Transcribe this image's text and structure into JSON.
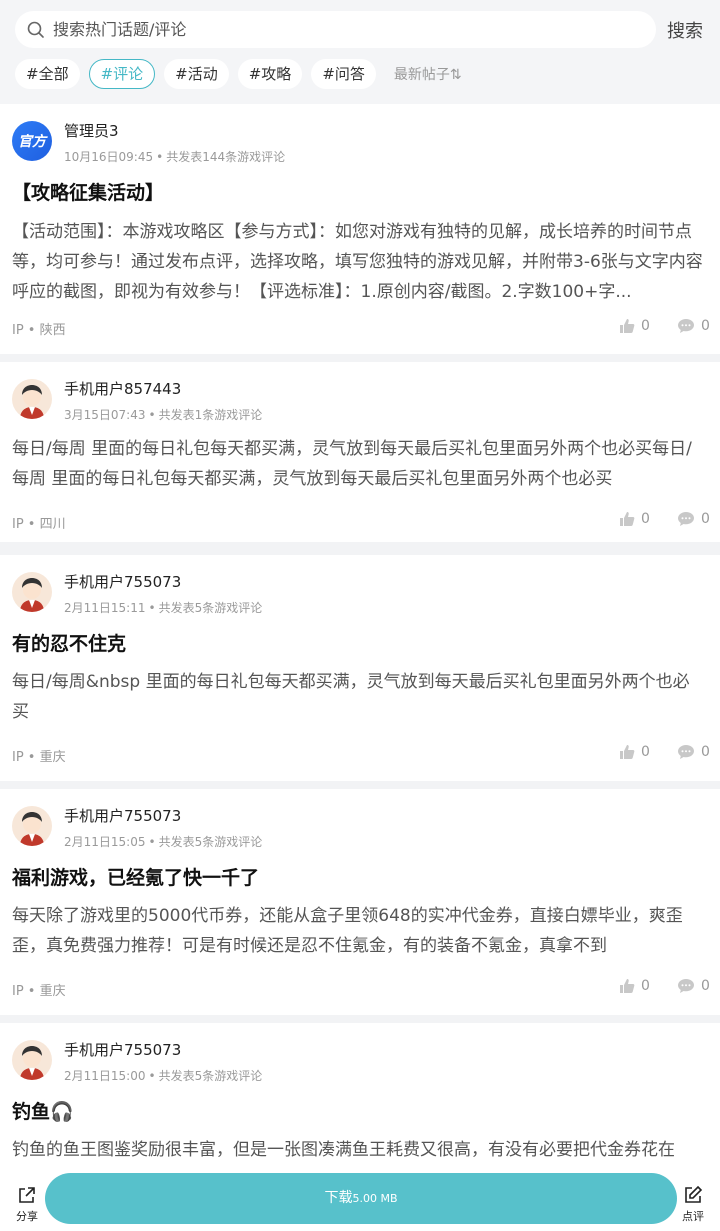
{
  "search": {
    "placeholder": "搜索热门话题/评论",
    "button_label": "搜索"
  },
  "tags": [
    "#全部",
    "#评论",
    "#活动",
    "#攻略",
    "#问答"
  ],
  "active_tag_index": 1,
  "sort_label": "最新帖子⇅",
  "posts": [
    {
      "user": "管理员3",
      "avatar_text": "官方",
      "time": "10月16日09:45",
      "count": "共发表144条游戏评论",
      "title": "【攻略征集活动】",
      "body": "【活动范围】：本游戏攻略区【参与方式】：如您对游戏有独特的见解，成长培养的时间节点等，均可参与！通过发布点评，选择攻略，填写您独特的游戏见解，并附带3-6张与文字内容呼应的截图，即视为有效参与！【评选标准】：1.原创内容/截图。2.字数100+字...",
      "ip": "IP • 陕西",
      "likes": "0",
      "comments": "0"
    },
    {
      "user": "手机用户857443",
      "time": "3月15日07:43",
      "count": "共发表1条游戏评论",
      "title": "",
      "body": "每日/每周 里面的每日礼包每天都买满，灵气放到每天最后买礼包里面另外两个也必买每日/每周 里面的每日礼包每天都买满，灵气放到每天最后买礼包里面另外两个也必买",
      "ip": "IP • 四川",
      "likes": "0",
      "comments": "0"
    },
    {
      "user": "手机用户755073",
      "time": "2月11日15:11",
      "count": "共发表5条游戏评论",
      "title": "有的忍不住克",
      "body": "每日/每周&nbsp 里面的每日礼包每天都买满，灵气放到每天最后买礼包里面另外两个也必买",
      "ip": "IP • 重庆",
      "likes": "0",
      "comments": "0"
    },
    {
      "user": "手机用户755073",
      "time": "2月11日15:05",
      "count": "共发表5条游戏评论",
      "title": "福利游戏，已经氪了快一千了",
      "body": "每天除了游戏里的5000代币券，还能从盒子里领648的实冲代金券，直接白嫖毕业，爽歪歪，真免费强力推荐！可是有时候还是忍不住氪金，有的装备不氪金，真拿不到",
      "ip": "IP • 重庆",
      "likes": "0",
      "comments": "0"
    },
    {
      "user": "手机用户755073",
      "time": "2月11日15:00",
      "count": "共发表5条游戏评论",
      "title": "钓鱼🎧",
      "body": "钓鱼的鱼王图鉴奖励很丰富，但是一张图凑满鱼王耗费又很高，有没有必要把代金券花在",
      "ip": "",
      "likes": "",
      "comments": ""
    }
  ],
  "bottom": {
    "share_label": "分享",
    "download_label": "下载",
    "download_size": "5.00 MB",
    "review_label": "点评"
  },
  "colors": {
    "accent": "#57c1cb",
    "tag_active": "#45b8c6"
  }
}
